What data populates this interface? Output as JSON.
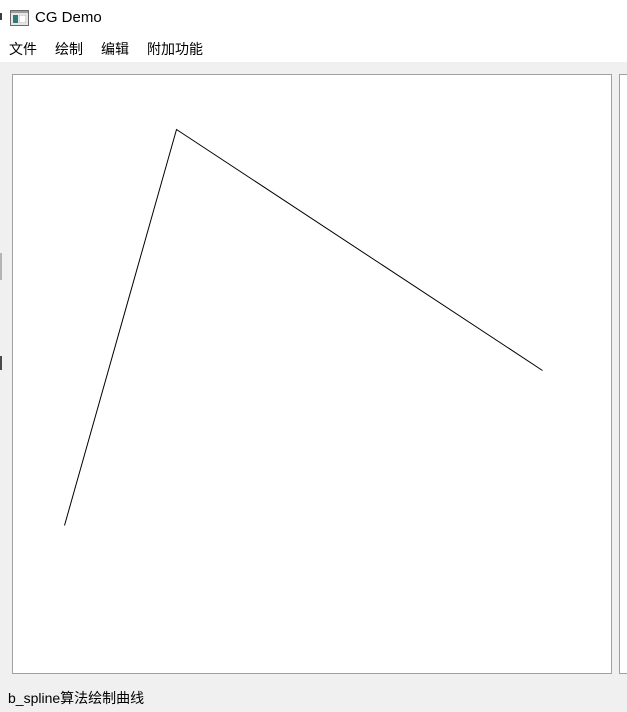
{
  "window": {
    "title": "CG Demo",
    "icon": "app-window-icon"
  },
  "menu": {
    "items": [
      {
        "label": "文件"
      },
      {
        "label": "绘制"
      },
      {
        "label": "编辑"
      },
      {
        "label": "附加功能"
      }
    ]
  },
  "canvas": {
    "background": "#ffffff",
    "stroke_color": "#000000"
  },
  "status_bar": {
    "message": "b_spline算法绘制曲线"
  },
  "colors": {
    "chrome_background": "#f0f0f0",
    "frame_border": "#a0a0a0"
  }
}
